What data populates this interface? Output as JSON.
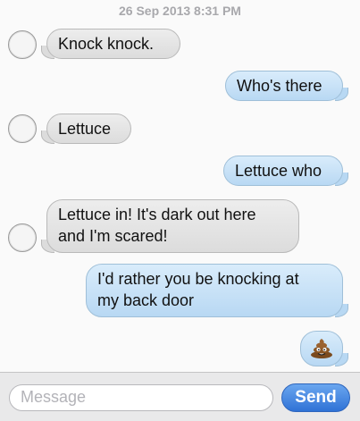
{
  "header": {
    "timestamp": "26 Sep 2013 8:31 PM"
  },
  "messages": [
    {
      "direction": "incoming",
      "text": "Knock knock."
    },
    {
      "direction": "outgoing",
      "text": "Who's there"
    },
    {
      "direction": "incoming",
      "text": "Lettuce"
    },
    {
      "direction": "outgoing",
      "text": "Lettuce who"
    },
    {
      "direction": "incoming",
      "line1": "Lettuce in! It's dark out here",
      "line2": "and I'm scared!"
    },
    {
      "direction": "outgoing",
      "line1": "I'd rather you be knocking at",
      "line2": "my back door"
    },
    {
      "direction": "outgoing",
      "icon": "pile-of-poo-emoji"
    }
  ],
  "composer": {
    "placeholder": "Message",
    "send_label": "Send"
  },
  "colors": {
    "incoming_bubble": "#e3e3e3",
    "outgoing_bubble": "#c6e0f6",
    "send_button": "#3c7fe0"
  }
}
